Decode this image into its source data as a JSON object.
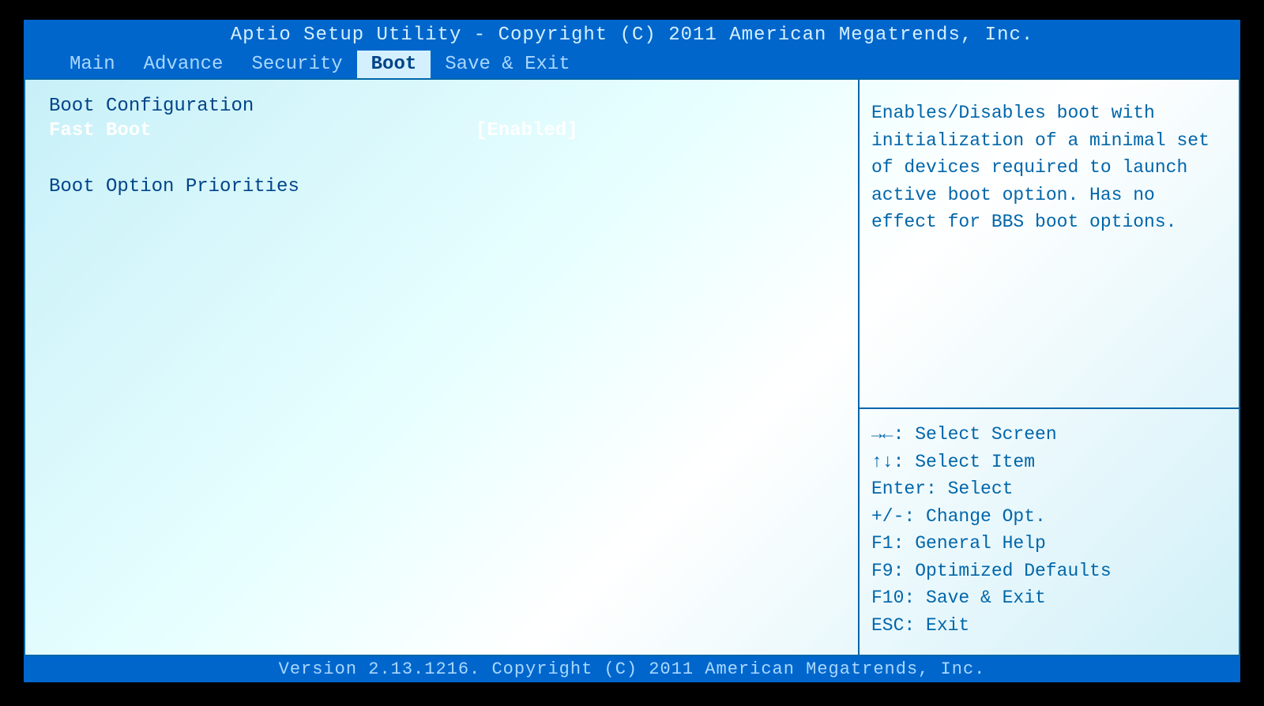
{
  "header": {
    "title": "Aptio Setup Utility - Copyright (C) 2011 American Megatrends, Inc."
  },
  "tabs": [
    {
      "label": "Main",
      "active": false
    },
    {
      "label": "Advance",
      "active": false
    },
    {
      "label": "Security",
      "active": false
    },
    {
      "label": "Boot",
      "active": true
    },
    {
      "label": "Save & Exit",
      "active": false
    }
  ],
  "main": {
    "section1_title": "Boot Configuration",
    "fast_boot_label": "Fast Boot",
    "fast_boot_value": "[Enabled]",
    "section2_title": "Boot Option Priorities"
  },
  "help": {
    "text": "Enables/Disables boot with initialization of a minimal set of devices required to launch active boot option. Has no effect for BBS boot options."
  },
  "keys": {
    "select_screen": "→←: Select Screen",
    "select_item": "↑↓: Select Item",
    "enter": "Enter: Select",
    "change": "+/-: Change Opt.",
    "f1": "F1: General Help",
    "f9": "F9: Optimized Defaults",
    "f10": "F10: Save & Exit",
    "esc": "ESC: Exit"
  },
  "footer": {
    "text": "Version 2.13.1216. Copyright (C) 2011 American Megatrends, Inc."
  }
}
